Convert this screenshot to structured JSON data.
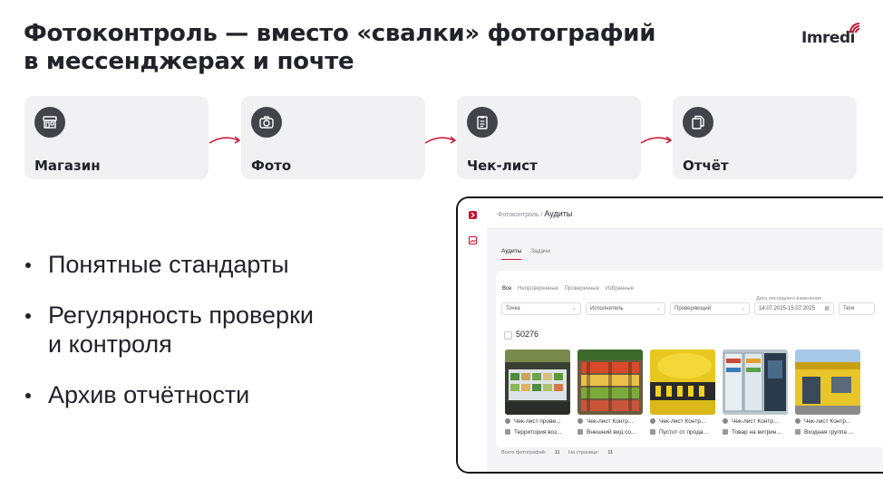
{
  "slide": {
    "title_line1": "Фотоконтроль — вместо «свалки» фотографий",
    "title_line2": "в мессенджерах и почте",
    "logo_text": "Imredi"
  },
  "steps": [
    {
      "label": "Магазин",
      "icon": "store-icon"
    },
    {
      "label": "Фото",
      "icon": "camera-icon"
    },
    {
      "label": "Чек-лист",
      "icon": "checklist-icon"
    },
    {
      "label": "Отчёт",
      "icon": "report-icon"
    }
  ],
  "bullets": [
    "Понятные стандарты",
    "Регулярность проверки\nи контроля",
    "Архив отчётности"
  ],
  "app": {
    "breadcrumb_parent": "Фотоконтроль /",
    "breadcrumb_current": "Аудиты",
    "tabs": [
      "Аудиты",
      "Задачи"
    ],
    "filter_tabs": [
      "Все",
      "Непроверенные",
      "Проверенные",
      "Избранные"
    ],
    "filters": {
      "point": "Точка",
      "executor": "Исполнитель",
      "reviewer": "Проверяющий",
      "date_label": "Дата последнего изменения",
      "date_value": "14.07.2025-15.07.2025",
      "tags": "Теги"
    },
    "count": "50276",
    "photos": [
      {
        "line1": "Чек-лист прове...",
        "line2": "Территория воз..."
      },
      {
        "line1": "Чек-лист Контр...",
        "line2": "Внешний вид со..."
      },
      {
        "line1": "Чек-лист Контр...",
        "line2": "Пустот от прода..."
      },
      {
        "line1": "Чек-лист Контр...",
        "line2": "Товар на витрин..."
      },
      {
        "line1": "Чек-лист Контр...",
        "line2": "Входная группа ..."
      }
    ],
    "footer": {
      "total_label": "Всего фотографий:",
      "total_value": "11",
      "per_page_label": "На странице:",
      "per_page_value": "11"
    }
  },
  "colors": {
    "accent": "#c8102e",
    "icon_bg": "#43434c",
    "card_bg": "#f1f1f3"
  }
}
